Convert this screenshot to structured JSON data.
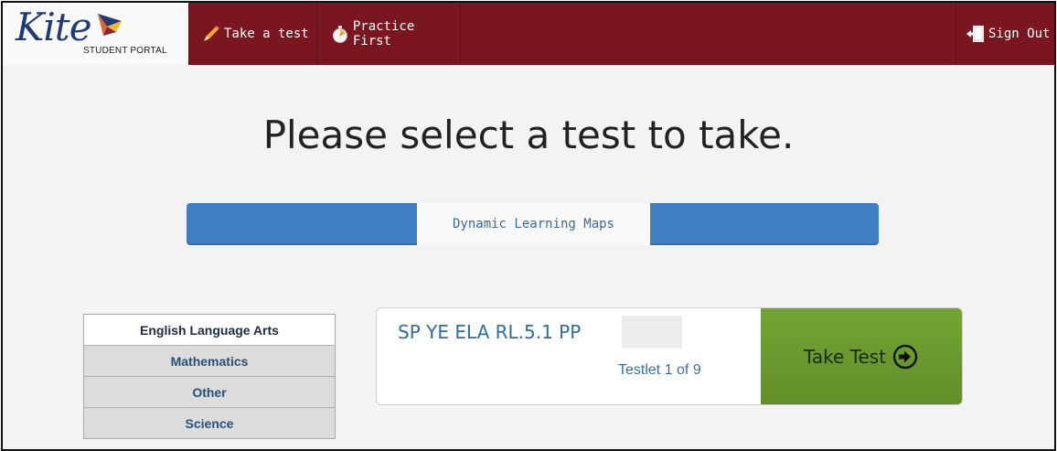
{
  "brand": {
    "logo_word": "Kite",
    "logo_sub": "STUDENT PORTAL",
    "logo_color": "#1e3a7d"
  },
  "nav": {
    "take_test": "Take a test",
    "practice_first": "Practice First",
    "sign_out": "Sign Out",
    "bar_color": "#7a1620"
  },
  "main": {
    "title": "Please select a test to take.",
    "tabs": [
      {
        "label": "Dynamic Learning Maps",
        "active": true
      }
    ],
    "subjects": [
      {
        "label": "English Language Arts",
        "active": true
      },
      {
        "label": "Mathematics",
        "active": false
      },
      {
        "label": "Other",
        "active": false
      },
      {
        "label": "Science",
        "active": false
      }
    ],
    "test": {
      "name": "SP YE ELA RL.5.1 PP",
      "testlet": "Testlet 1 of 9",
      "button_label": "Take Test",
      "button_color": "#6b9c2e"
    }
  },
  "icons": [
    "pencil-icon",
    "stopwatch-icon",
    "exit-door-icon",
    "arrow-circle-right-icon",
    "kite-logo-icon"
  ]
}
